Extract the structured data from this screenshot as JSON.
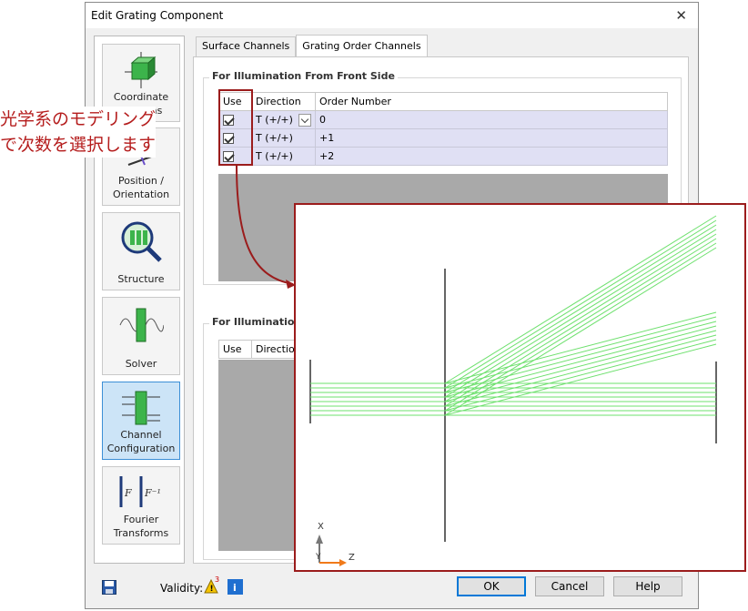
{
  "window": {
    "title": "Edit Grating Component",
    "close_glyph": "✕"
  },
  "sidebar": {
    "items": [
      {
        "label": "Coordinate Systems"
      },
      {
        "label": "Position / Orientation"
      },
      {
        "label": "Structure"
      },
      {
        "label": "Solver"
      },
      {
        "label": "Channel Configuration",
        "active": true
      },
      {
        "label": "Fourier Transforms"
      }
    ]
  },
  "tabs": [
    {
      "label": "Surface Channels"
    },
    {
      "label": "Grating Order Channels",
      "active": true
    }
  ],
  "front": {
    "title": "For Illumination From Front Side",
    "headers": {
      "use": "Use",
      "direction": "Direction",
      "order": "Order Number"
    },
    "rows": [
      {
        "direction": "T (+/+)",
        "order": "0"
      },
      {
        "direction": "T (+/+)",
        "order": "+1"
      },
      {
        "direction": "T (+/+)",
        "order": "+2"
      }
    ]
  },
  "back": {
    "title": "For Illumination",
    "headers": {
      "use": "Use",
      "direction": "Direction"
    }
  },
  "footer": {
    "validity_label": "Validity:",
    "warning_count": "3",
    "ok": "OK",
    "cancel": "Cancel",
    "help": "Help"
  },
  "annotation": {
    "line1": "光学系のモデリング",
    "line2": "で次数を選択します"
  },
  "plot": {
    "axis_x": "X",
    "axis_y": "Y",
    "axis_z": "Z"
  },
  "colors": {
    "annotation": "#b51d1d",
    "ray": "#6ee06e",
    "accent": "#0078d7"
  }
}
